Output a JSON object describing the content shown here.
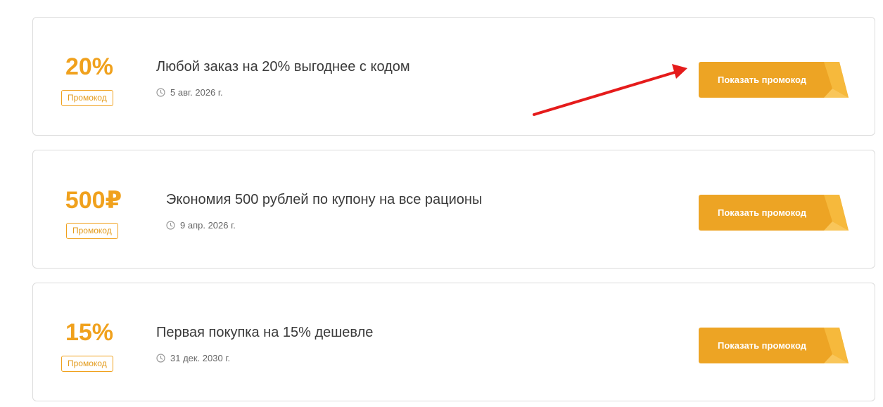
{
  "accent_color": "#f0a11d",
  "offers": [
    {
      "discount": "20%",
      "badge": "Промокод",
      "title": "Любой заказ на 20% выгоднее с кодом",
      "date": "5 авг. 2026 г.",
      "button_label": "Показать промокод"
    },
    {
      "discount": "500₽",
      "badge": "Промокод",
      "title": "Экономия 500 рублей по купону на все рационы",
      "date": "9 апр. 2026 г.",
      "button_label": "Показать промокод"
    },
    {
      "discount": "15%",
      "badge": "Промокод",
      "title": "Первая покупка на 15% дешевле",
      "date": "31 дек. 2030 г.",
      "button_label": "Показать промокод"
    }
  ],
  "annotation": {
    "arrow_color": "#e51b1b"
  }
}
